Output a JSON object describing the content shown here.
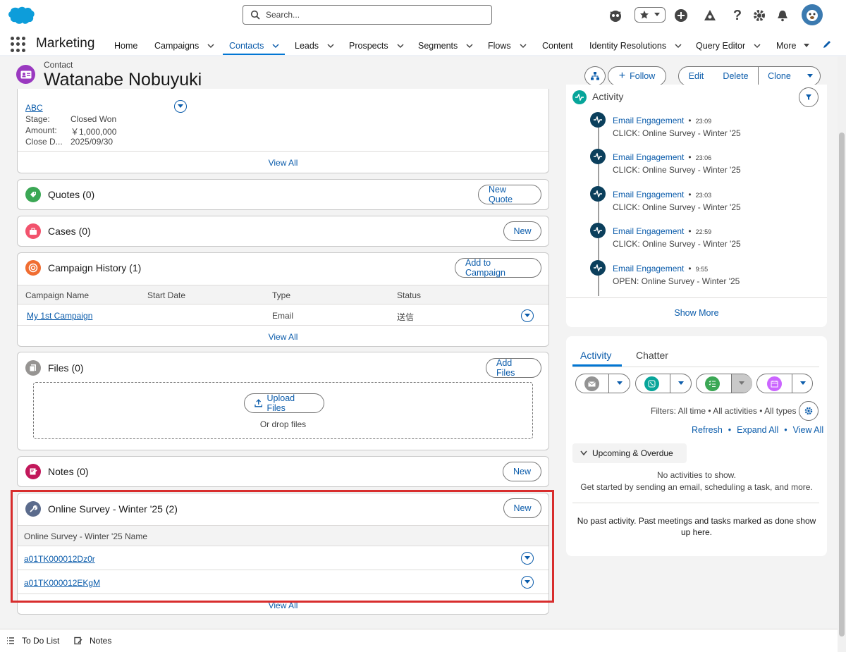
{
  "header": {
    "search_placeholder": "Search..."
  },
  "nav": {
    "app_name": "Marketing",
    "items": [
      {
        "label": "Home"
      },
      {
        "label": "Campaigns"
      },
      {
        "label": "Contacts"
      },
      {
        "label": "Leads"
      },
      {
        "label": "Prospects"
      },
      {
        "label": "Segments"
      },
      {
        "label": "Flows"
      },
      {
        "label": "Content"
      },
      {
        "label": "Identity Resolutions"
      },
      {
        "label": "Query Editor"
      },
      {
        "label": "More"
      }
    ]
  },
  "record": {
    "type": "Contact",
    "name": "Watanabe Nobuyuki",
    "follow": "Follow",
    "edit": "Edit",
    "delete": "Delete",
    "clone": "Clone"
  },
  "opportunity": {
    "name": "ABC",
    "stage_label": "Stage:",
    "stage": "Closed Won",
    "amount_label": "Amount:",
    "amount": "￥1,000,000",
    "close_label": "Close D...",
    "close": "2025/09/30",
    "view_all": "View All"
  },
  "quotes": {
    "title": "Quotes (0)",
    "button": "New Quote"
  },
  "cases": {
    "title": "Cases (0)",
    "button": "New"
  },
  "campaign_history": {
    "title": "Campaign History (1)",
    "button": "Add to Campaign",
    "columns": [
      "Campaign Name",
      "Start Date",
      "Type",
      "Status"
    ],
    "rows": [
      {
        "name": "My 1st Campaign",
        "start": "",
        "type": "Email",
        "status": "送信"
      }
    ],
    "view_all": "View All"
  },
  "files": {
    "title": "Files (0)",
    "button": "Add Files",
    "upload": "Upload Files",
    "drop": "Or drop files"
  },
  "notes": {
    "title": "Notes (0)",
    "button": "New"
  },
  "survey": {
    "title": "Online Survey - Winter '25 (2)",
    "button": "New",
    "column": "Online Survey - Winter '25 Name",
    "rows": [
      {
        "name": "a01TK000012Dz0r"
      },
      {
        "name": "a01TK000012EKgM"
      }
    ],
    "view_all": "View All"
  },
  "engagement": {
    "title": "Activity",
    "items": [
      {
        "label": "Email Engagement",
        "time": "23:09",
        "detail": "CLICK: Online Survey - Winter '25"
      },
      {
        "label": "Email Engagement",
        "time": "23:06",
        "detail": "CLICK: Online Survey - Winter '25"
      },
      {
        "label": "Email Engagement",
        "time": "23:03",
        "detail": "CLICK: Online Survey - Winter '25"
      },
      {
        "label": "Email Engagement",
        "time": "22:59",
        "detail": "CLICK: Online Survey - Winter '25"
      },
      {
        "label": "Email Engagement",
        "time": "9:55",
        "detail": "OPEN: Online Survey - Winter '25"
      }
    ],
    "show_more": "Show More"
  },
  "activity": {
    "tabs": [
      "Activity",
      "Chatter"
    ],
    "filters": "Filters: All time • All activities • All types",
    "refresh": "Refresh",
    "expand_all": "Expand All",
    "view_all": "View All",
    "upcoming": "Upcoming & Overdue",
    "no_activities": "No activities to show.",
    "get_started": "Get started by sending an email, scheduling a task, and more.",
    "no_past": "No past activity. Past meetings and tasks marked as done show up here."
  },
  "utility": {
    "todo": "To Do List",
    "notes": "Notes"
  },
  "colors": {
    "brand": "#0176d3",
    "link": "#0b5cab",
    "highlight": "#d82d2d",
    "engagement_icon": "#0b3f5c"
  },
  "icons": {
    "logo": "salesforce-cloud-logo",
    "search": "search-icon",
    "quotes": "quote-icon",
    "cases": "case-icon",
    "campaign": "campaign-icon",
    "files": "files-icon",
    "notes": "note-icon",
    "survey": "wrench-icon"
  }
}
